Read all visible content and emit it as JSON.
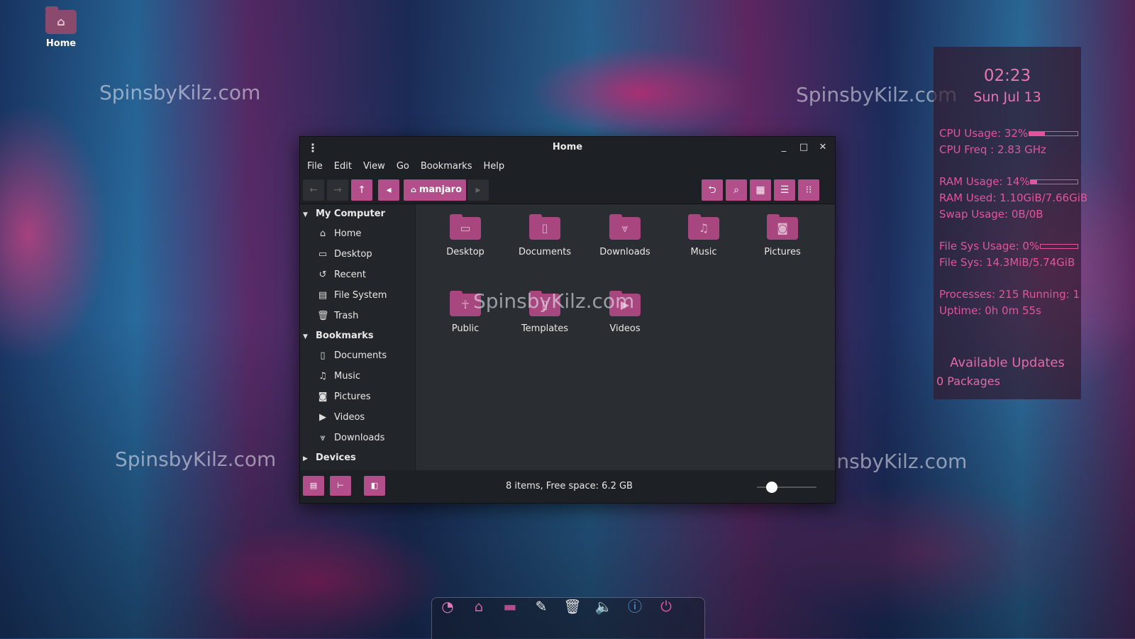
{
  "desktop": {
    "home_icon_label": "Home",
    "watermarks": [
      "SpinsbyKilz.com",
      "SpinsbyKilz.com",
      "SpinsbyKilz.com",
      "SpinsbyKilz.com",
      "SpinsbyKilz.com"
    ]
  },
  "window": {
    "title": "Home",
    "controls": {
      "minimize": "_",
      "maximize": "□",
      "close": "✕"
    },
    "menu": [
      "File",
      "Edit",
      "View",
      "Go",
      "Bookmarks",
      "Help"
    ],
    "breadcrumb": "manjaro",
    "sidebar": {
      "sections": [
        {
          "label": "My Computer",
          "items": [
            {
              "label": "Home",
              "icon": "home-icon"
            },
            {
              "label": "Desktop",
              "icon": "desktop-icon"
            },
            {
              "label": "Recent",
              "icon": "recent-icon"
            },
            {
              "label": "File System",
              "icon": "drive-icon"
            },
            {
              "label": "Trash",
              "icon": "trash-icon"
            }
          ]
        },
        {
          "label": "Bookmarks",
          "items": [
            {
              "label": "Documents",
              "icon": "document-icon"
            },
            {
              "label": "Music",
              "icon": "music-icon"
            },
            {
              "label": "Pictures",
              "icon": "camera-icon"
            },
            {
              "label": "Videos",
              "icon": "video-icon"
            },
            {
              "label": "Downloads",
              "icon": "download-icon"
            }
          ]
        },
        {
          "label": "Devices",
          "items": []
        }
      ]
    },
    "files": [
      {
        "label": "Desktop",
        "icon": "desktop-folder-icon"
      },
      {
        "label": "Documents",
        "icon": "documents-folder-icon"
      },
      {
        "label": "Downloads",
        "icon": "downloads-folder-icon"
      },
      {
        "label": "Music",
        "icon": "music-folder-icon"
      },
      {
        "label": "Pictures",
        "icon": "pictures-folder-icon"
      },
      {
        "label": "Public",
        "icon": "public-folder-icon"
      },
      {
        "label": "Templates",
        "icon": "templates-folder-icon"
      },
      {
        "label": "Videos",
        "icon": "videos-folder-icon"
      }
    ],
    "content_watermark": "SpinsbyKilz.com",
    "status": "8 items, Free space: 6.2 GB",
    "zoom_level": 0.25
  },
  "conky": {
    "time": "02:23",
    "date": "Sun Jul 13",
    "cpu_usage": "CPU Usage: 32%",
    "cpu_usage_fraction": 0.32,
    "cpu_freq": "CPU Freq : 2.83 GHz",
    "ram_usage": "RAM Usage: 14%",
    "ram_usage_fraction": 0.14,
    "ram_used": "RAM Used: 1.10GiB/7.66GiB",
    "swap": "Swap Usage: 0B/0B",
    "fs_usage": "File Sys Usage:  0%",
    "fs_usage_fraction": 0.0,
    "fs": "File Sys: 14.3MiB/5.74GiB",
    "processes": "Processes: 215   Running: 1",
    "uptime": "Uptime: 0h 0m 55s",
    "updates_title": "Available Updates",
    "updates_count": "0 Packages"
  },
  "colors": {
    "accent": "#b24f8a",
    "conky_text": "#e0559c",
    "window_bg": "#22262a"
  }
}
